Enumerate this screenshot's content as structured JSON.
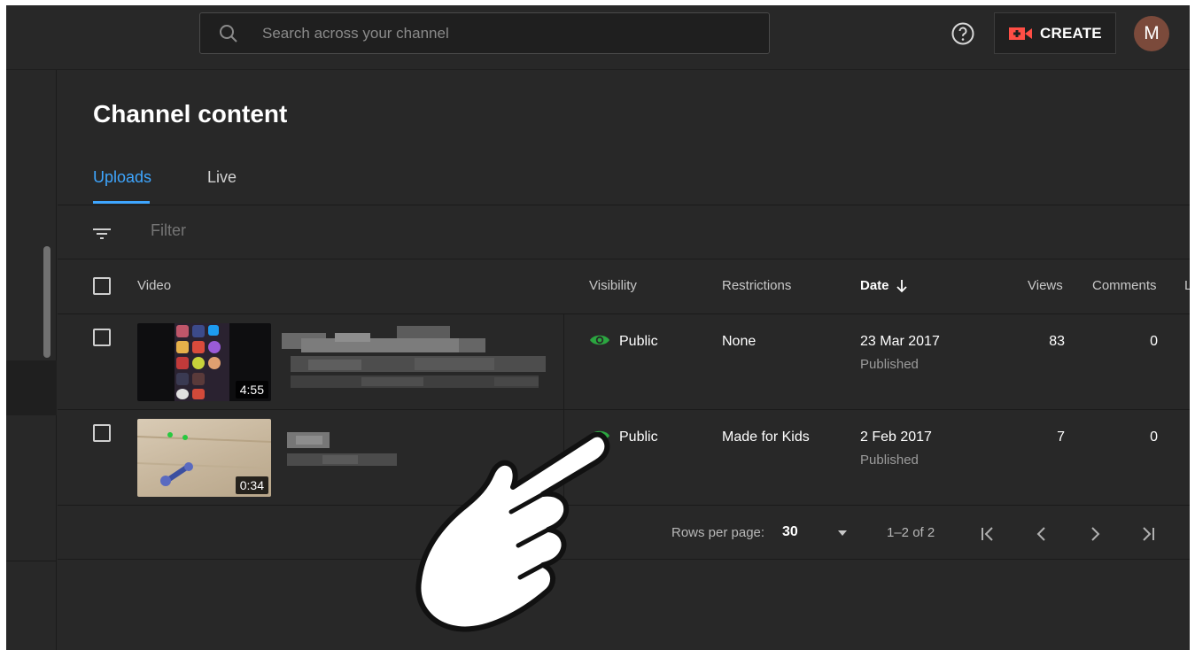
{
  "header": {
    "search_placeholder": "Search across your channel",
    "create_label": "CREATE",
    "avatar_letter": "M"
  },
  "page": {
    "title": "Channel content",
    "tabs": [
      {
        "label": "Uploads",
        "selected": true
      },
      {
        "label": "Live",
        "selected": false
      }
    ],
    "filter_placeholder": "Filter"
  },
  "table": {
    "columns": [
      "Video",
      "Visibility",
      "Restrictions",
      "Date",
      "Views",
      "Comments",
      "L"
    ],
    "sorted_column": "Date",
    "rows": [
      {
        "duration": "4:55",
        "visibility": "Public",
        "restrictions": "None",
        "date": "23 Mar 2017",
        "date_status": "Published",
        "views": "83",
        "comments": "0"
      },
      {
        "duration": "0:34",
        "visibility": "Public",
        "restrictions": "Made for Kids",
        "date": "2 Feb 2017",
        "date_status": "Published",
        "views": "7",
        "comments": "0"
      }
    ]
  },
  "pagination": {
    "rows_per_page_label": "Rows per page:",
    "rows_per_page": "30",
    "range": "1–2 of 2"
  },
  "colors": {
    "accent": "#3ea6ff",
    "create_red": "#ff4e45",
    "public_green": "#2ba640",
    "background": "#282828"
  }
}
